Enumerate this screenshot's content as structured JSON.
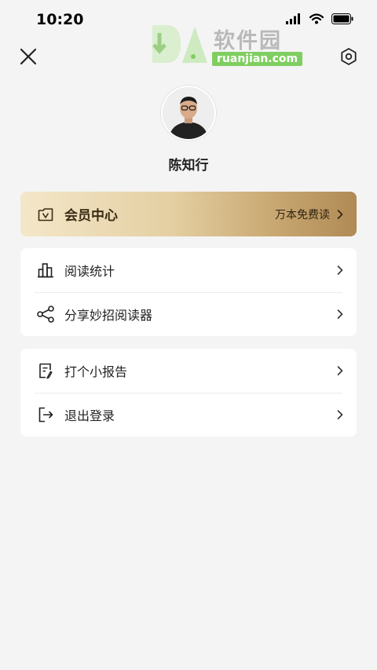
{
  "status_bar": {
    "time": "10:20"
  },
  "watermark": {
    "brand_text": "软件园",
    "url": "ruanjian.com",
    "logo_text": "DA"
  },
  "profile": {
    "username": "陈知行"
  },
  "vip": {
    "label": "会员中心",
    "promo": "万本免费读"
  },
  "menu_group_1": [
    {
      "label": "阅读统计",
      "icon": "bar-chart-icon"
    },
    {
      "label": "分享妙招阅读器",
      "icon": "share-icon"
    }
  ],
  "menu_group_2": [
    {
      "label": "打个小报告",
      "icon": "report-icon"
    },
    {
      "label": "退出登录",
      "icon": "logout-icon"
    }
  ],
  "colors": {
    "background": "#f4f4f4",
    "card": "#ffffff",
    "vip_gradient_start": "#f4e7c9",
    "vip_gradient_end": "#b08a55",
    "watermark_green": "#7fce60"
  }
}
